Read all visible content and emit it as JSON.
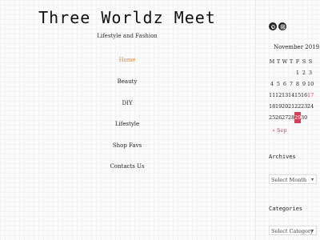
{
  "site": {
    "title": "Three Worldz Meet",
    "tagline": "Lifestyle and Fashion"
  },
  "nav": {
    "items": [
      {
        "label": "Home",
        "active": true
      },
      {
        "label": "Beauty",
        "active": false
      },
      {
        "label": "DIY",
        "active": false
      },
      {
        "label": "Lifestyle",
        "active": false
      },
      {
        "label": "Shop Favs",
        "active": false
      },
      {
        "label": "Contacts Us",
        "active": false
      }
    ]
  },
  "sidebar": {
    "social_icons": [
      "pinterest-icon",
      "instagram-icon"
    ],
    "calendar": {
      "month": "November 2019",
      "weekdays": [
        "M",
        "T",
        "W",
        "T",
        "F",
        "S",
        "S"
      ],
      "weeks": [
        [
          "",
          "",
          "",
          "",
          "1",
          "2",
          "3"
        ],
        [
          "4",
          "5",
          "6",
          "7",
          "8",
          "9",
          "10"
        ],
        [
          "11",
          "12",
          "13",
          "14",
          "15",
          "16",
          "17"
        ],
        [
          "18",
          "19",
          "20",
          "21",
          "22",
          "23",
          "24"
        ],
        [
          "25",
          "26",
          "27",
          "28",
          "29",
          "30",
          ""
        ]
      ],
      "today": "29",
      "prev_link": "« Sep"
    },
    "archives": {
      "title": "Archives",
      "select_value": "Select Month"
    },
    "categories": {
      "title": "Categories",
      "select_value": "Select Category"
    }
  },
  "colors": {
    "accent": "#d98b3a",
    "calendar_highlight": "#d4405a"
  }
}
